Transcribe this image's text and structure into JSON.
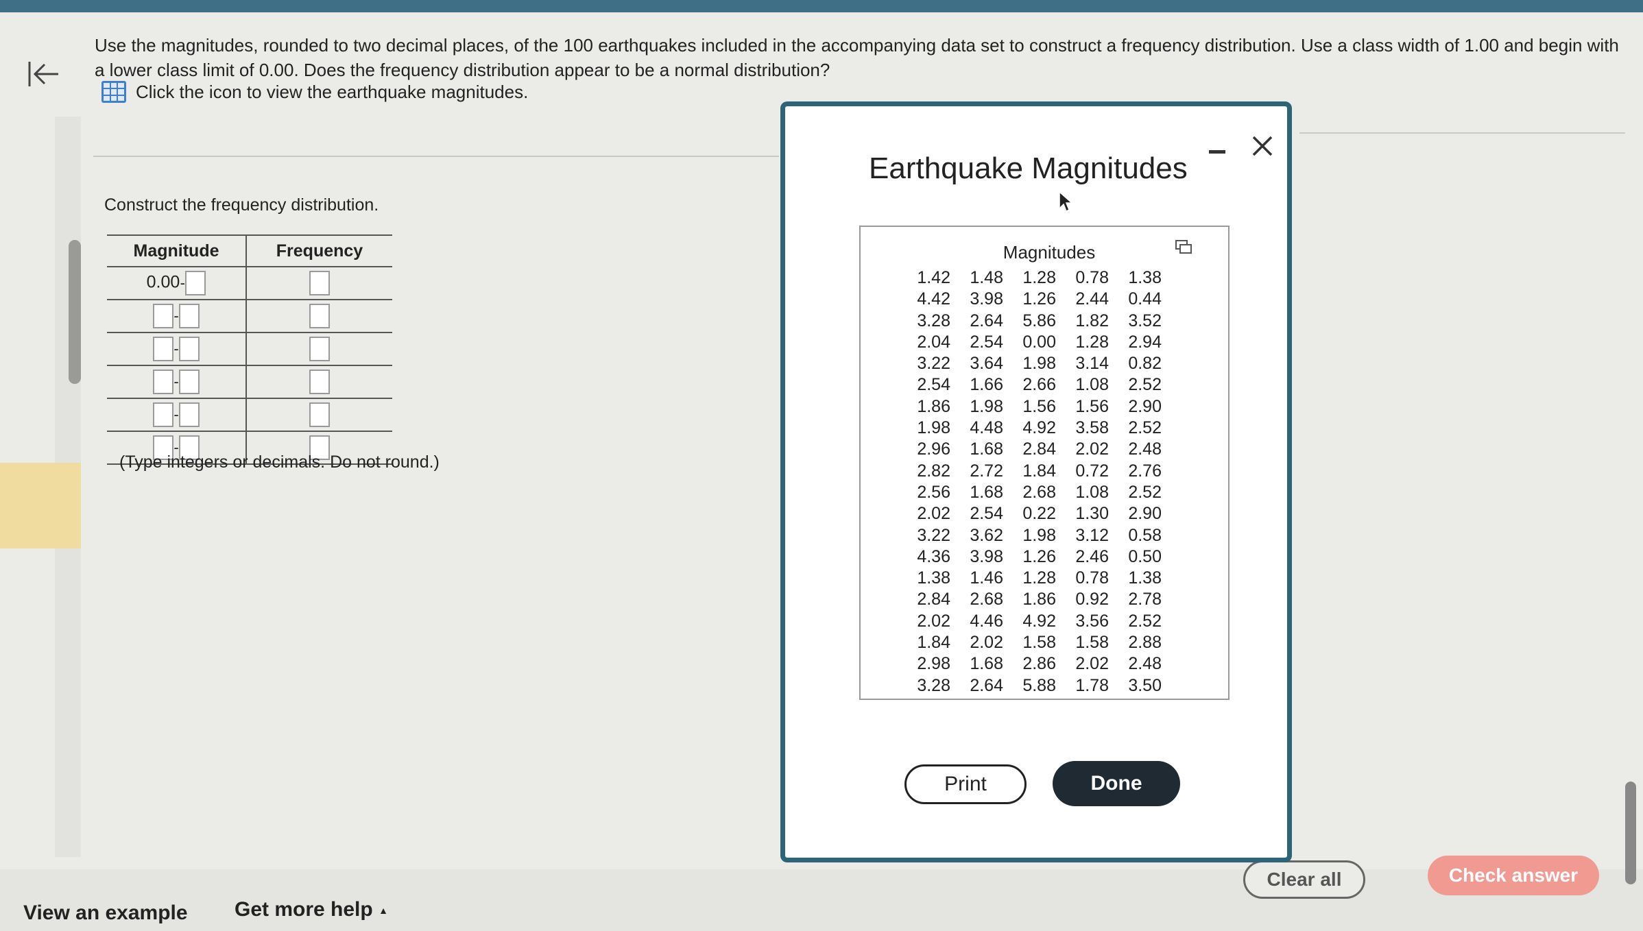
{
  "question": {
    "text": "Use the magnitudes, rounded to two decimal places, of the 100 earthquakes included in the accompanying data set to construct a frequency distribution. Use a class width of 1.00 and begin with a lower class limit of 0.00. Does the frequency distribution appear to be a normal distribution?",
    "icon_link": "Click the icon to view the earthquake magnitudes."
  },
  "construct_label": "Construct the frequency distribution.",
  "table": {
    "headers": [
      "Magnitude",
      "Frequency"
    ],
    "first_lower": "0.00",
    "dash": "-"
  },
  "type_note": "(Type integers or decimals. Do not round.)",
  "modal": {
    "title": "Earthquake Magnitudes",
    "column_title": "Magnitudes",
    "values": [
      "1.42",
      "1.48",
      "1.28",
      "0.78",
      "1.38",
      "4.42",
      "3.98",
      "1.26",
      "2.44",
      "0.44",
      "3.28",
      "2.64",
      "5.86",
      "1.82",
      "3.52",
      "2.04",
      "2.54",
      "0.00",
      "1.28",
      "2.94",
      "3.22",
      "3.64",
      "1.98",
      "3.14",
      "0.82",
      "2.54",
      "1.66",
      "2.66",
      "1.08",
      "2.52",
      "1.86",
      "1.98",
      "1.56",
      "1.56",
      "2.90",
      "1.98",
      "4.48",
      "4.92",
      "3.58",
      "2.52",
      "2.96",
      "1.68",
      "2.84",
      "2.02",
      "2.48",
      "2.82",
      "2.72",
      "1.84",
      "0.72",
      "2.76",
      "2.56",
      "1.68",
      "2.68",
      "1.08",
      "2.52",
      "2.02",
      "2.54",
      "0.22",
      "1.30",
      "2.90",
      "3.22",
      "3.62",
      "1.98",
      "3.12",
      "0.58",
      "4.36",
      "3.98",
      "1.26",
      "2.46",
      "0.50",
      "1.38",
      "1.46",
      "1.28",
      "0.78",
      "1.38",
      "2.84",
      "2.68",
      "1.86",
      "0.92",
      "2.78",
      "2.02",
      "4.46",
      "4.92",
      "3.56",
      "2.52",
      "1.84",
      "2.02",
      "1.58",
      "1.58",
      "2.88",
      "2.98",
      "1.68",
      "2.86",
      "2.02",
      "2.48",
      "3.28",
      "2.64",
      "5.88",
      "1.78",
      "3.50"
    ],
    "print_label": "Print",
    "done_label": "Done"
  },
  "footer": {
    "view_example": "View an example",
    "get_more_help": "Get more help",
    "help_arrow": "▲",
    "clear_all": "Clear all",
    "check_answer": "Check answer"
  },
  "colors": {
    "modal_border": "#2e6478",
    "done_bg": "#1f2a33",
    "check_answer_bg": "#f19a92",
    "icon_blue": "#3f7fd0"
  }
}
